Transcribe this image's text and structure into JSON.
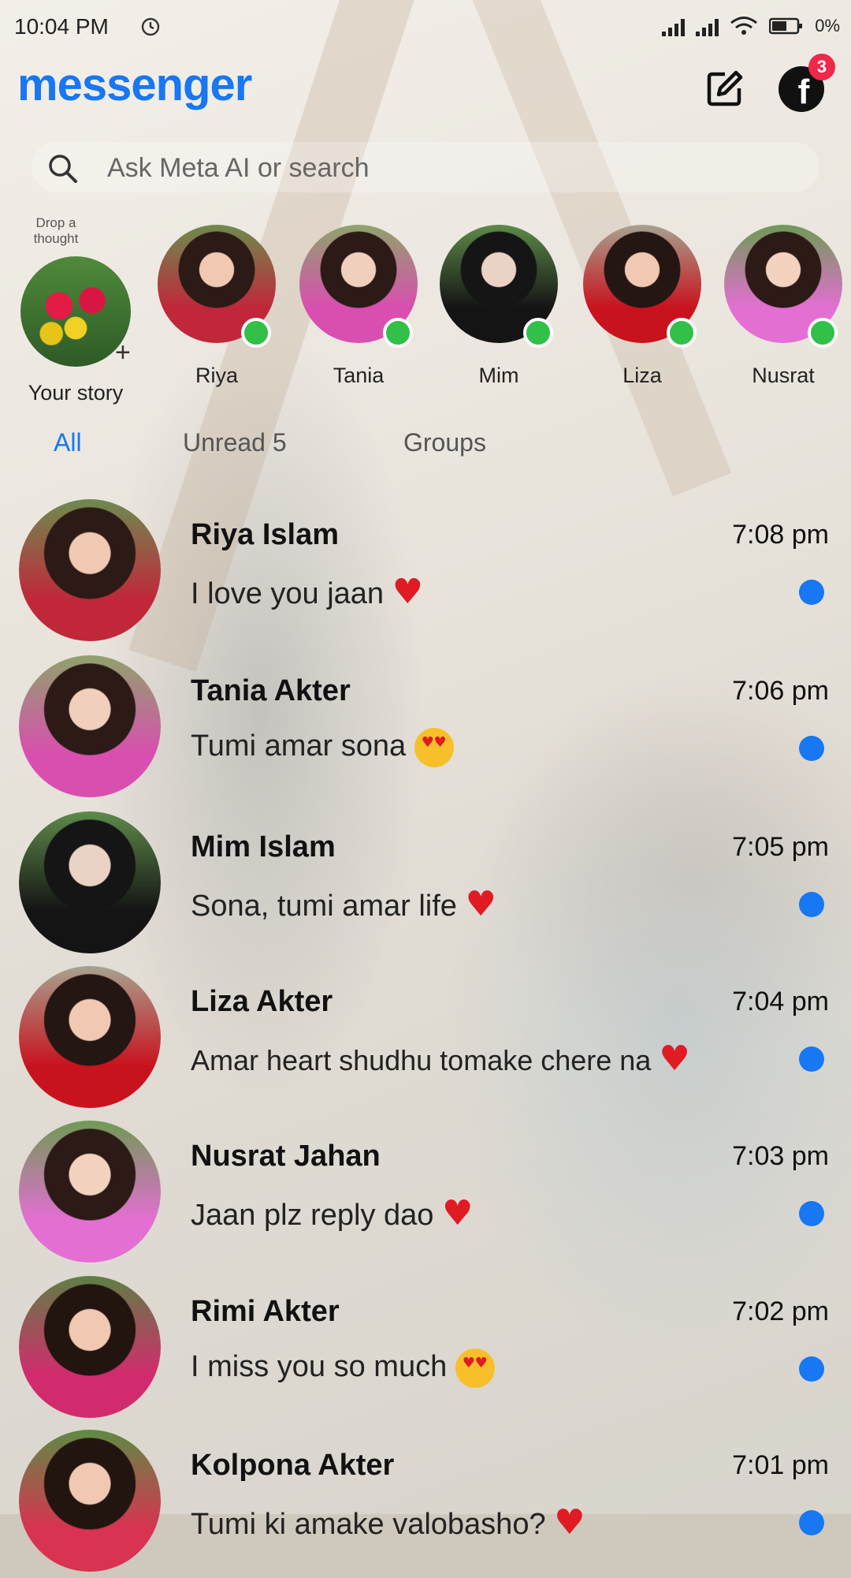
{
  "status_bar": {
    "time": "10:04 PM",
    "network_label": "0",
    "battery_label": "0%"
  },
  "header": {
    "logo": "messenger",
    "notification_count": "3"
  },
  "search": {
    "placeholder": "Ask Meta AI or search"
  },
  "stories": {
    "thought_label": "Drop a thought",
    "your_story_label": "Your story",
    "items": [
      {
        "name": "Riya"
      },
      {
        "name": "Tania"
      },
      {
        "name": "Mim"
      },
      {
        "name": "Liza"
      },
      {
        "name": "Nusrat"
      }
    ]
  },
  "filters": {
    "all": "All",
    "unread": "Unread 5",
    "groups": "Groups"
  },
  "chats": [
    {
      "name": "Riya Islam",
      "message": "I love you jaan",
      "time": "7:08 pm",
      "emoji": "heart"
    },
    {
      "name": "Tania Akter",
      "message": "Tumi amar sona",
      "time": "7:06 pm",
      "emoji": "heart-eyes"
    },
    {
      "name": "Mim Islam",
      "message": "Sona, tumi amar life",
      "time": "7:05 pm",
      "emoji": "heart"
    },
    {
      "name": "Liza Akter",
      "message": "Amar heart shudhu tomake chere na",
      "time": "7:04 pm",
      "emoji": "heart"
    },
    {
      "name": "Nusrat Jahan",
      "message": "Jaan plz reply dao",
      "time": "7:03 pm",
      "emoji": "heart"
    },
    {
      "name": "Rimi Akter",
      "message": "I miss you so much",
      "time": "7:02 pm",
      "emoji": "heart-eyes"
    },
    {
      "name": "Kolpona Akter",
      "message": "Tumi ki amake valobasho?",
      "time": "7:01 pm",
      "emoji": "heart"
    }
  ],
  "colors": {
    "brand_blue": "#1877f2",
    "online_green": "#31c048",
    "badge_red": "#f02849"
  }
}
